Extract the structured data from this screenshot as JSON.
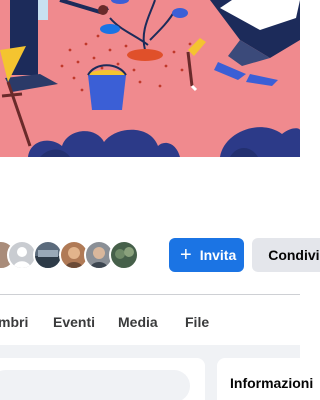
{
  "actions": {
    "invite_label": "Invita",
    "share_label": "Condividi"
  },
  "tabs": [
    {
      "label": "mbri"
    },
    {
      "label": "Eventi"
    },
    {
      "label": "Media"
    },
    {
      "label": "File"
    }
  ],
  "info_card": {
    "title": "Informazioni"
  },
  "icons": {
    "invite": "plus-icon",
    "share": "share-arrow-icon"
  },
  "colors": {
    "primary": "#1b74e4",
    "secondary": "#e4e6eb",
    "cover": "#f08a8e",
    "page_bg": "#f0f2f5"
  }
}
